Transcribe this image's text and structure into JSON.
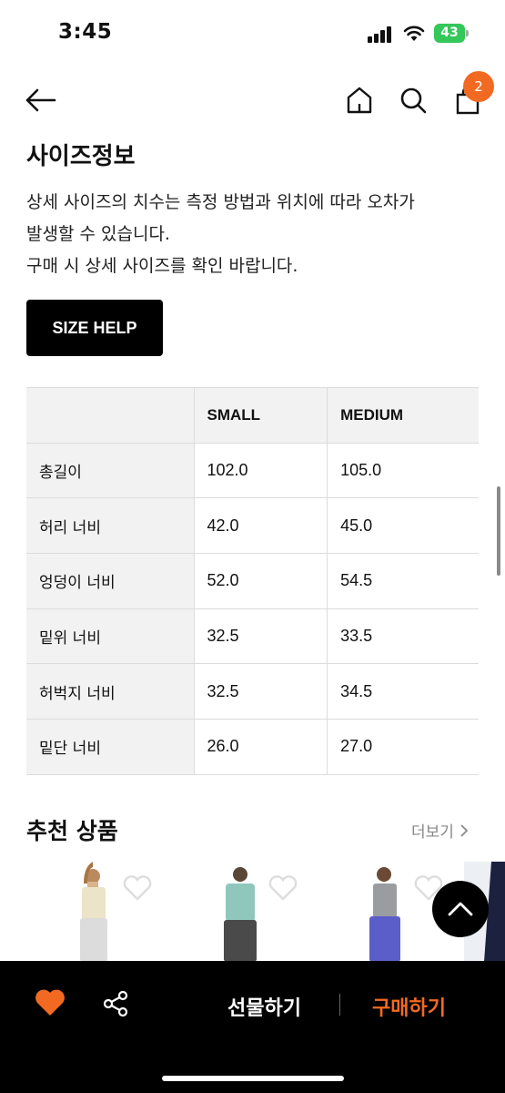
{
  "status_bar": {
    "time": "3:45",
    "battery": "43"
  },
  "header": {
    "cart_count": "2"
  },
  "size_info": {
    "title": "사이즈정보",
    "description": [
      "상세 사이즈의 치수는 측정 방법과 위치에 따라 오차가",
      "발생할 수 있습니다.",
      "구매 시 상세 사이즈를 확인 바랍니다."
    ],
    "help_button": "SIZE HELP"
  },
  "size_table": {
    "columns": [
      "",
      "SMALL",
      "MEDIUM"
    ],
    "rows": [
      {
        "label": "총길이",
        "small": "102.0",
        "medium": "105.0"
      },
      {
        "label": "허리 너비",
        "small": "42.0",
        "medium": "45.0"
      },
      {
        "label": "엉덩이 너비",
        "small": "52.0",
        "medium": "54.5"
      },
      {
        "label": "밑위 너비",
        "small": "32.5",
        "medium": "33.5"
      },
      {
        "label": "허벅지 너비",
        "small": "32.5",
        "medium": "34.5"
      },
      {
        "label": "밑단 너비",
        "small": "26.0",
        "medium": "27.0"
      }
    ]
  },
  "recommended": {
    "title": "추천 상품",
    "more_label": "더보기"
  },
  "bottom_bar": {
    "gift_label": "선물하기",
    "buy_label": "구매하기"
  },
  "colors": {
    "accent": "#f26a21",
    "battery": "#34c759"
  }
}
